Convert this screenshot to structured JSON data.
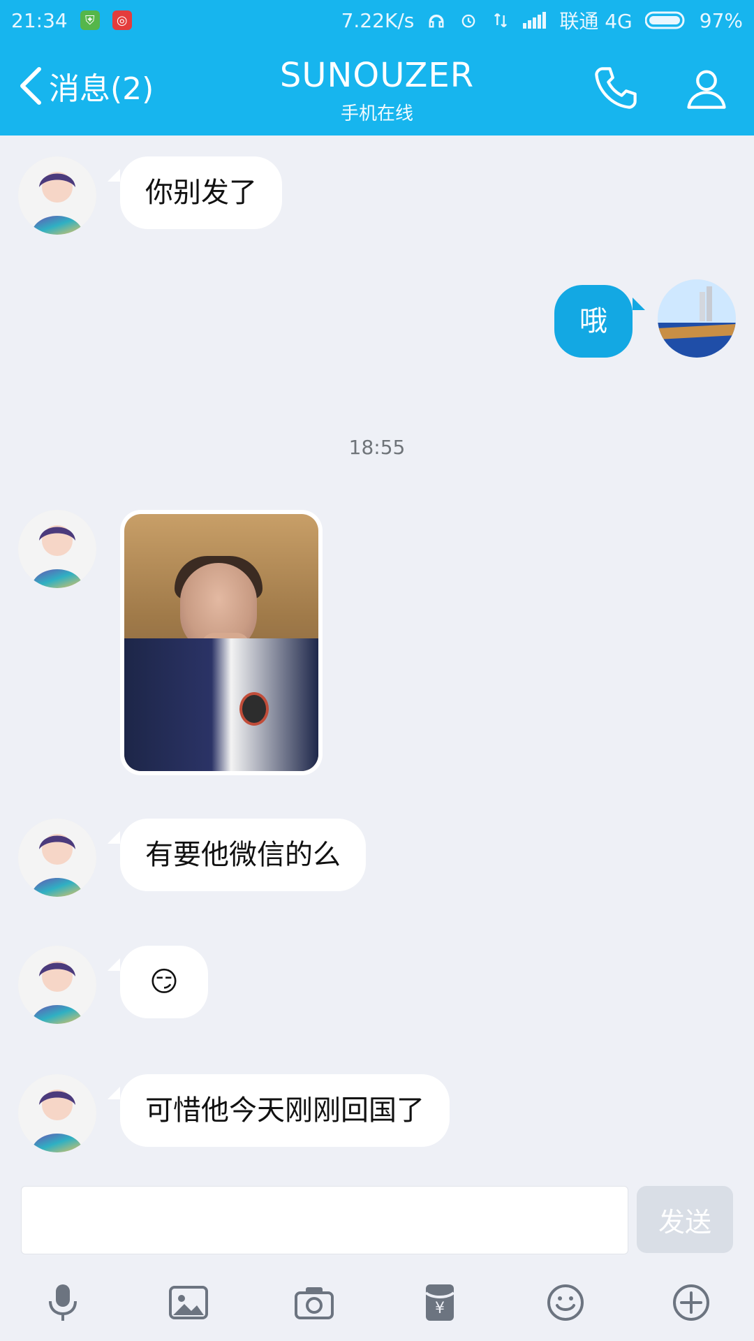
{
  "status_bar": {
    "time": "21:34",
    "speed": "7.22K/s",
    "carrier": "联通 4G",
    "battery": "97%"
  },
  "header": {
    "back_label": "消息(2)",
    "title": "SUNOUZER",
    "subtitle": "手机在线"
  },
  "messages": [
    {
      "side": "left",
      "text": "你别发了"
    },
    {
      "side": "right",
      "text": "哦"
    },
    {
      "type": "timestamp",
      "text": "18:55"
    },
    {
      "side": "left",
      "type": "image"
    },
    {
      "side": "left",
      "text": "有要他微信的么"
    },
    {
      "side": "left",
      "text": "😏"
    },
    {
      "side": "left",
      "text": "可惜他今天刚刚回国了"
    }
  ],
  "input": {
    "send_label": "发送"
  },
  "icons": {
    "back": "chevron-left-icon",
    "call": "phone-icon",
    "profile": "user-icon",
    "mic": "microphone-icon",
    "gallery": "image-icon",
    "camera": "camera-icon",
    "red_packet": "red-packet-icon",
    "emoji": "emoji-icon",
    "more": "plus-circle-icon"
  },
  "colors": {
    "header_blue": "#17b5ee",
    "bubble_blue": "#13a8e3",
    "background": "#eef0f6"
  }
}
